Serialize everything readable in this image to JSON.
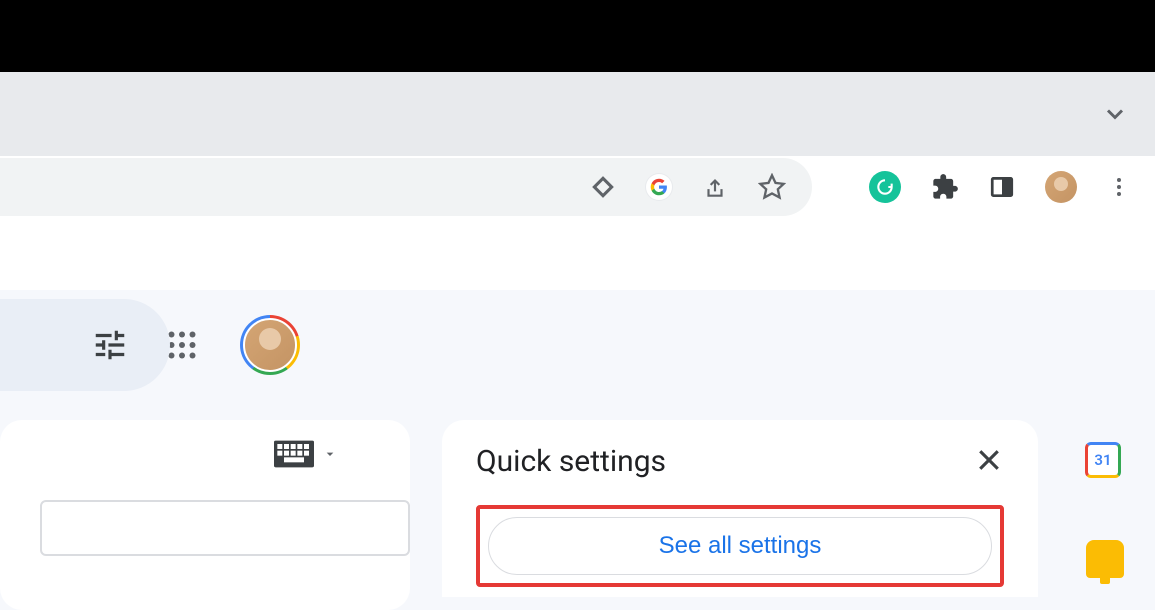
{
  "browser": {
    "omnibox_icons": [
      "lews-icon",
      "google-search-icon",
      "share-icon",
      "star-icon"
    ],
    "right_icons": [
      "grammarly-icon",
      "extensions-icon",
      "sidepanel-icon",
      "profile-avatar",
      "menu-icon"
    ]
  },
  "gmail_header": {
    "icons": [
      "tune-icon",
      "support-icon",
      "settings-icon",
      "apps-icon",
      "account-avatar"
    ]
  },
  "left_panel": {
    "keyboard_icon": "keyboard-icon"
  },
  "quick_settings": {
    "title": "Quick settings",
    "see_all_label": "See all settings"
  },
  "side_rail": {
    "calendar_day": "31"
  }
}
